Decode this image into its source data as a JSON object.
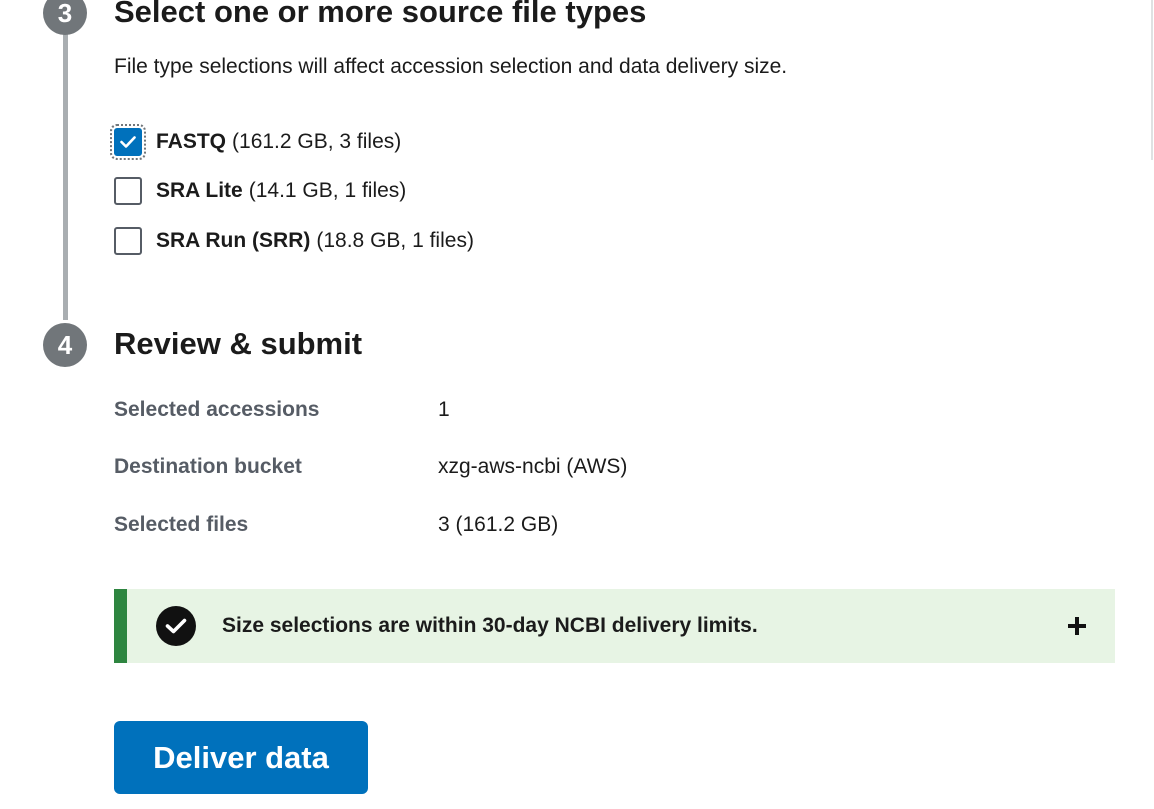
{
  "step3": {
    "number": "3",
    "title": "Select one or more source file types",
    "description": "File type selections will affect accession selection and data delivery size.",
    "options": [
      {
        "name": "FASTQ",
        "meta": "(161.2 GB, 3 files)",
        "checked": true
      },
      {
        "name": "SRA Lite",
        "meta": "(14.1 GB, 1 files)",
        "checked": false
      },
      {
        "name": "SRA Run (SRR)",
        "meta": "(18.8 GB, 1 files)",
        "checked": false
      }
    ]
  },
  "step4": {
    "number": "4",
    "title": "Review & submit",
    "review": [
      {
        "label": "Selected accessions",
        "value": "1"
      },
      {
        "label": "Destination bucket",
        "value": "xzg-aws-ncbi (AWS)"
      },
      {
        "label": "Selected files",
        "value": "3 (161.2 GB)"
      }
    ]
  },
  "alert": {
    "icon": "check-circle-icon",
    "text": "Size selections are within 30-day NCBI delivery limits.",
    "toggle_icon": "plus-icon",
    "status_color": "#2e8540"
  },
  "deliver_button": {
    "label": "Deliver data"
  },
  "colors": {
    "primary": "#0071bc",
    "step_circle": "#71767a",
    "success_bg": "#e7f4e4"
  }
}
